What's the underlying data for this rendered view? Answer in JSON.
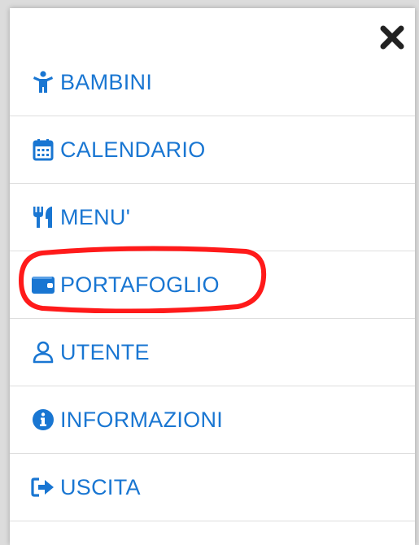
{
  "accent_color": "#1976d2",
  "highlight_color": "#ff1a1a",
  "menu": {
    "close_icon": "close-icon",
    "items": [
      {
        "label": "BAMBINI",
        "icon": "child-icon"
      },
      {
        "label": "CALENDARIO",
        "icon": "calendar-icon"
      },
      {
        "label": "MENU'",
        "icon": "utensils-icon"
      },
      {
        "label": "PORTAFOGLIO",
        "icon": "wallet-icon"
      },
      {
        "label": "UTENTE",
        "icon": "user-icon"
      },
      {
        "label": "INFORMAZIONI",
        "icon": "info-icon"
      },
      {
        "label": "USCITA",
        "icon": "logout-icon"
      }
    ]
  }
}
